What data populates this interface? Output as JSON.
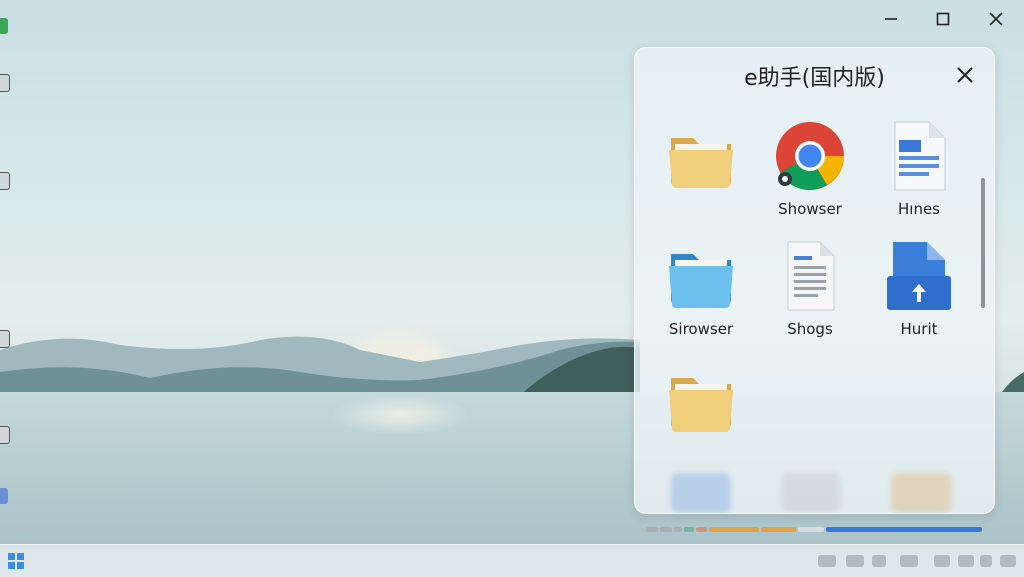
{
  "window_controls": {
    "minimize_icon": "minimize-icon",
    "maximize_icon": "maximize-icon",
    "close_icon": "close-icon"
  },
  "panel": {
    "title": "e助手(国内版)",
    "close_icon": "close-icon",
    "items": [
      {
        "label": "",
        "icon": "folder-icon"
      },
      {
        "label": "Showser",
        "icon": "chrome-icon"
      },
      {
        "label": "Hınes",
        "icon": "document-icon"
      },
      {
        "label": "Sirowser",
        "icon": "folder-blue-icon"
      },
      {
        "label": "Shogs",
        "icon": "text-file-icon"
      },
      {
        "label": "Hurit",
        "icon": "blue-file-upload-icon"
      },
      {
        "label": "",
        "icon": "folder-icon"
      }
    ]
  },
  "colors": {
    "accent": "#3a78d8",
    "folder": "#e8c26a",
    "folder_blue": "#5fb4e8"
  }
}
